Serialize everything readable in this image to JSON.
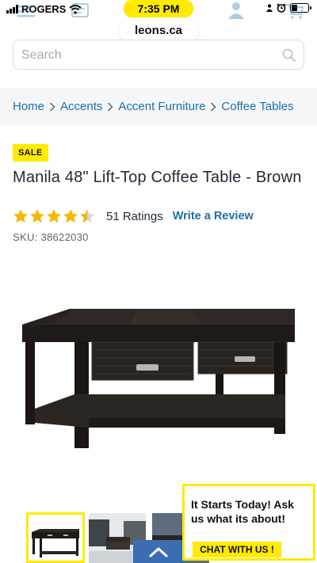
{
  "status_bar": {
    "carrier": "ROGERS",
    "time": "7:35 PM",
    "battery_level": 0.35
  },
  "browser": {
    "url": "leons.ca"
  },
  "search": {
    "placeholder": "Search"
  },
  "breadcrumb": {
    "items": [
      "Home",
      "Accents",
      "Accent Furniture",
      "Coffee Tables"
    ]
  },
  "product": {
    "badge": "SALE",
    "title": "Manila 48\" Lift-Top Coffee Table - Brown",
    "rating": 4.5,
    "rating_max": 5,
    "ratings_count": "51 Ratings",
    "write_review": "Write a Review",
    "sku": "SKU: 38622030"
  },
  "chat": {
    "message": "It Starts Today! Ask us what its about!",
    "button": "CHAT WITH US !"
  },
  "colors": {
    "accent_yellow": "#ffea00",
    "link_blue": "#1e6fa8",
    "star_gold": "#f5b800",
    "breadcrumb_bg": "#f4f6f8"
  }
}
